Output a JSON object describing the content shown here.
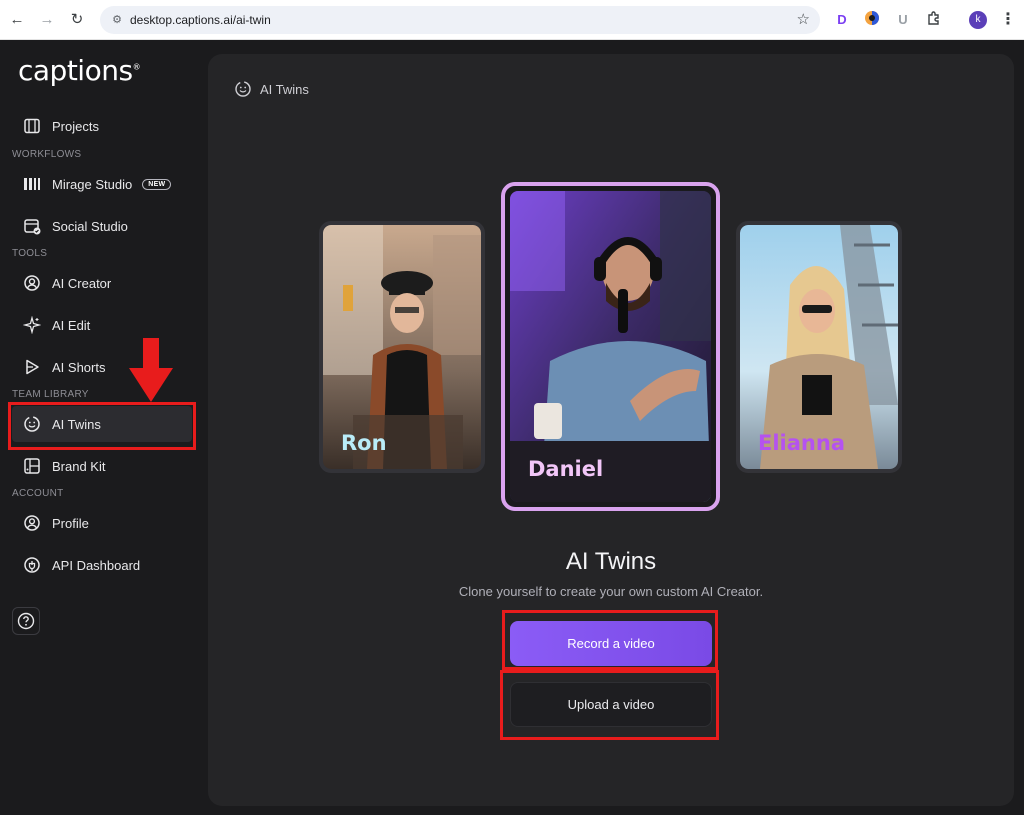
{
  "browser": {
    "url": "desktop.captions.ai/ai-twin",
    "avatar_letter": "k",
    "extensions": [
      "D",
      "U"
    ]
  },
  "app": {
    "logo": "captions",
    "logo_mark": "®"
  },
  "sidebar": {
    "items": [
      {
        "label": "Projects",
        "icon": "film-icon"
      },
      {
        "label": "Mirage Studio",
        "icon": "mirage-icon",
        "badge": "NEW"
      },
      {
        "label": "Social Studio",
        "icon": "calendar-check-icon"
      },
      {
        "label": "AI Creator",
        "icon": "ai-creator-icon"
      },
      {
        "label": "AI Edit",
        "icon": "sparkle-icon"
      },
      {
        "label": "AI Shorts",
        "icon": "shorts-icon"
      },
      {
        "label": "AI Twins",
        "icon": "smile-icon",
        "active": true
      },
      {
        "label": "Brand Kit",
        "icon": "brand-kit-icon"
      },
      {
        "label": "Profile",
        "icon": "user-icon"
      },
      {
        "label": "API Dashboard",
        "icon": "api-icon"
      }
    ],
    "sections": [
      "WORKFLOWS",
      "TOOLS",
      "TEAM LIBRARY",
      "ACCOUNT"
    ]
  },
  "main": {
    "breadcrumb": "AI Twins",
    "cards": [
      {
        "name": "Ron",
        "color": "#b9ecf8"
      },
      {
        "name": "Daniel",
        "color": "#f2c6f8"
      },
      {
        "name": "Elianna",
        "color": "#b552f0"
      }
    ],
    "title": "AI Twins",
    "subtitle": "Clone yourself to create your own custom AI Creator.",
    "record_label": "Record a video",
    "upload_label": "Upload a video"
  },
  "colors": {
    "accent": "#8b5cf6",
    "highlight": "#e81c1c",
    "selected_border": "#d9a3ee"
  }
}
